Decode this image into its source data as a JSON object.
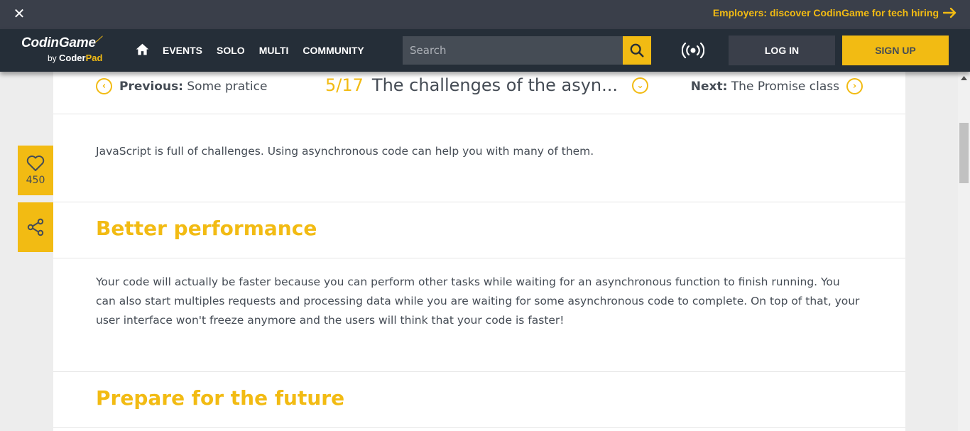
{
  "banner": {
    "close_icon": "close-icon",
    "promo_text": "Employers: discover CodinGame for tech hiring",
    "promo_icon": "arrow-right-icon"
  },
  "brand": {
    "name": "CodinGame",
    "by": "by",
    "coder": "Coder",
    "pad": "Pad",
    "accent_color": "#f2bb13",
    "nav_bg": "#252e38"
  },
  "nav": {
    "items": [
      "EVENTS",
      "SOLO",
      "MULTI",
      "COMMUNITY"
    ],
    "search_placeholder": "Search",
    "login_label": "LOG IN",
    "signup_label": "SIGN UP"
  },
  "lesson_nav": {
    "prev_label": "Previous:",
    "prev_title": "Some pratice",
    "position": "5/17",
    "current_title": "The challenges of the asyn...",
    "next_label": "Next:",
    "next_title": "The Promise class"
  },
  "content": {
    "intro": "JavaScript is full of challenges. Using asynchronous code can help you with many of them.",
    "section1_title": "Better performance",
    "section1_text": "Your code will actually be faster because you can perform other tasks while waiting for an asynchronous function to finish running. You can also start multiples requests and processing data while you are waiting for some asynchronous code to complete. On top of that, your user interface won't freeze anymore and the users will think that your code is faster!",
    "section2_title": "Prepare for the future"
  },
  "side": {
    "like_count": "450"
  }
}
